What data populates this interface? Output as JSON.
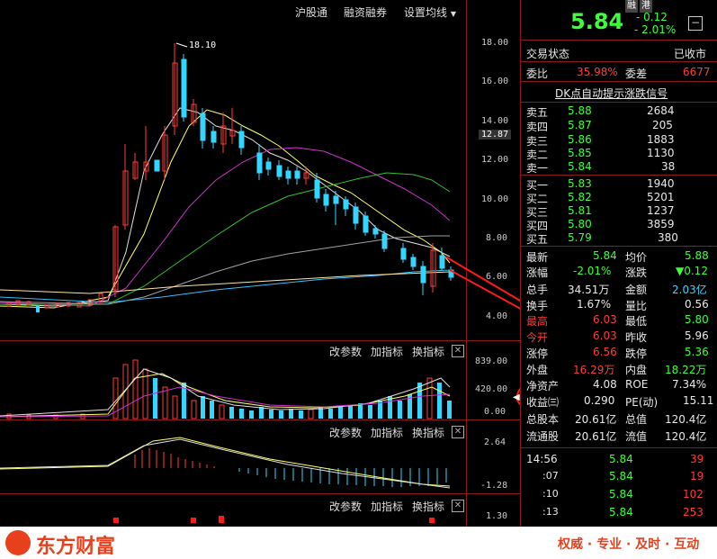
{
  "toolbar": {
    "items": [
      "沪股通",
      "融资融券",
      "设置均线"
    ]
  },
  "main_chart": {
    "y_ticks": [
      "18.00",
      "16.00",
      "14.00",
      "12.00",
      "10.00",
      "8.00",
      "6.00",
      "4.00"
    ],
    "current_price_label": "12.87",
    "high_annotation": "18.10"
  },
  "volume_panel": {
    "buttons": [
      "改参数",
      "加指标",
      "换指标"
    ],
    "y_ticks": [
      "839.00",
      "420.00",
      "0.00"
    ]
  },
  "macd_panel": {
    "buttons": [
      "改参数",
      "加指标",
      "换指标"
    ],
    "y_ticks": [
      "2.64",
      "-1.28"
    ]
  },
  "bottom_panel": {
    "buttons": [
      "改参数",
      "加指标",
      "换指标"
    ],
    "y_ticks": [
      "1.30"
    ]
  },
  "quote": {
    "badges": [
      "融",
      "港"
    ],
    "price": "5.84",
    "change": "0.12",
    "change_pct": "- 2.01%",
    "trade_status_label": "交易状态",
    "trade_status_value": "已收市",
    "weibi_label": "委比",
    "weibi_value": "35.98%",
    "weicha_label": "委差",
    "weicha_value": "6677",
    "signal_link": "DK点自动提示涨跌信号",
    "asks": [
      {
        "label": "卖五",
        "price": "5.88",
        "vol": "2684"
      },
      {
        "label": "卖四",
        "price": "5.87",
        "vol": "205"
      },
      {
        "label": "卖三",
        "price": "5.86",
        "vol": "1883"
      },
      {
        "label": "卖二",
        "price": "5.85",
        "vol": "1130"
      },
      {
        "label": "卖一",
        "price": "5.84",
        "vol": "38"
      }
    ],
    "bids": [
      {
        "label": "买一",
        "price": "5.83",
        "vol": "1940"
      },
      {
        "label": "买二",
        "price": "5.82",
        "vol": "5201"
      },
      {
        "label": "买三",
        "price": "5.81",
        "vol": "1237"
      },
      {
        "label": "买四",
        "price": "5.80",
        "vol": "3859"
      },
      {
        "label": "买五",
        "price": "5.79",
        "vol": "380"
      }
    ],
    "stats": [
      {
        "l1": "最新",
        "v1": "5.84",
        "l2": "均价",
        "v2": "5.88"
      },
      {
        "l1": "涨幅",
        "v1": "-2.01%",
        "l2": "涨跌",
        "v2": "▼0.12"
      },
      {
        "l1": "总手",
        "v1": "34.51万",
        "l2": "金额",
        "v2": "2.03亿"
      },
      {
        "l1": "换手",
        "v1": "1.67%",
        "l2": "量比",
        "v2": "0.56"
      },
      {
        "l1": "最高",
        "v1": "6.03",
        "l2": "最低",
        "v2": "5.80"
      },
      {
        "l1": "今开",
        "v1": "6.03",
        "l2": "昨收",
        "v2": "5.96"
      },
      {
        "l1": "涨停",
        "v1": "6.56",
        "l2": "跌停",
        "v2": "5.36"
      },
      {
        "l1": "外盘",
        "v1": "16.29万",
        "l2": "内盘",
        "v2": "18.22万"
      },
      {
        "l1": "净资产",
        "v1": "4.08",
        "l2": "ROE",
        "v2": "7.34%"
      },
      {
        "l1": "收益㈢",
        "v1": "0.290",
        "l2": "PE(动)",
        "v2": "15.11"
      },
      {
        "l1": "总股本",
        "v1": "20.61亿",
        "l2": "总值",
        "v2": "120.4亿"
      },
      {
        "l1": "流通股",
        "v1": "20.61亿",
        "l2": "流值",
        "v2": "120.4亿"
      }
    ],
    "ticks": [
      {
        "time": "14:56",
        "price": "5.84",
        "vol": "39"
      },
      {
        "time": ":07",
        "price": "5.84",
        "vol": "19"
      },
      {
        "time": ":10",
        "price": "5.84",
        "vol": "102"
      },
      {
        "time": ":13",
        "price": "5.84",
        "vol": "253"
      }
    ]
  },
  "footer": {
    "brand": "东方财富",
    "slogan": "权威 · 专业 · 及时 · 互动"
  },
  "colors": {
    "up": "#ff3b3b",
    "down": "#33d6ff",
    "accent": "#e8401c"
  }
}
